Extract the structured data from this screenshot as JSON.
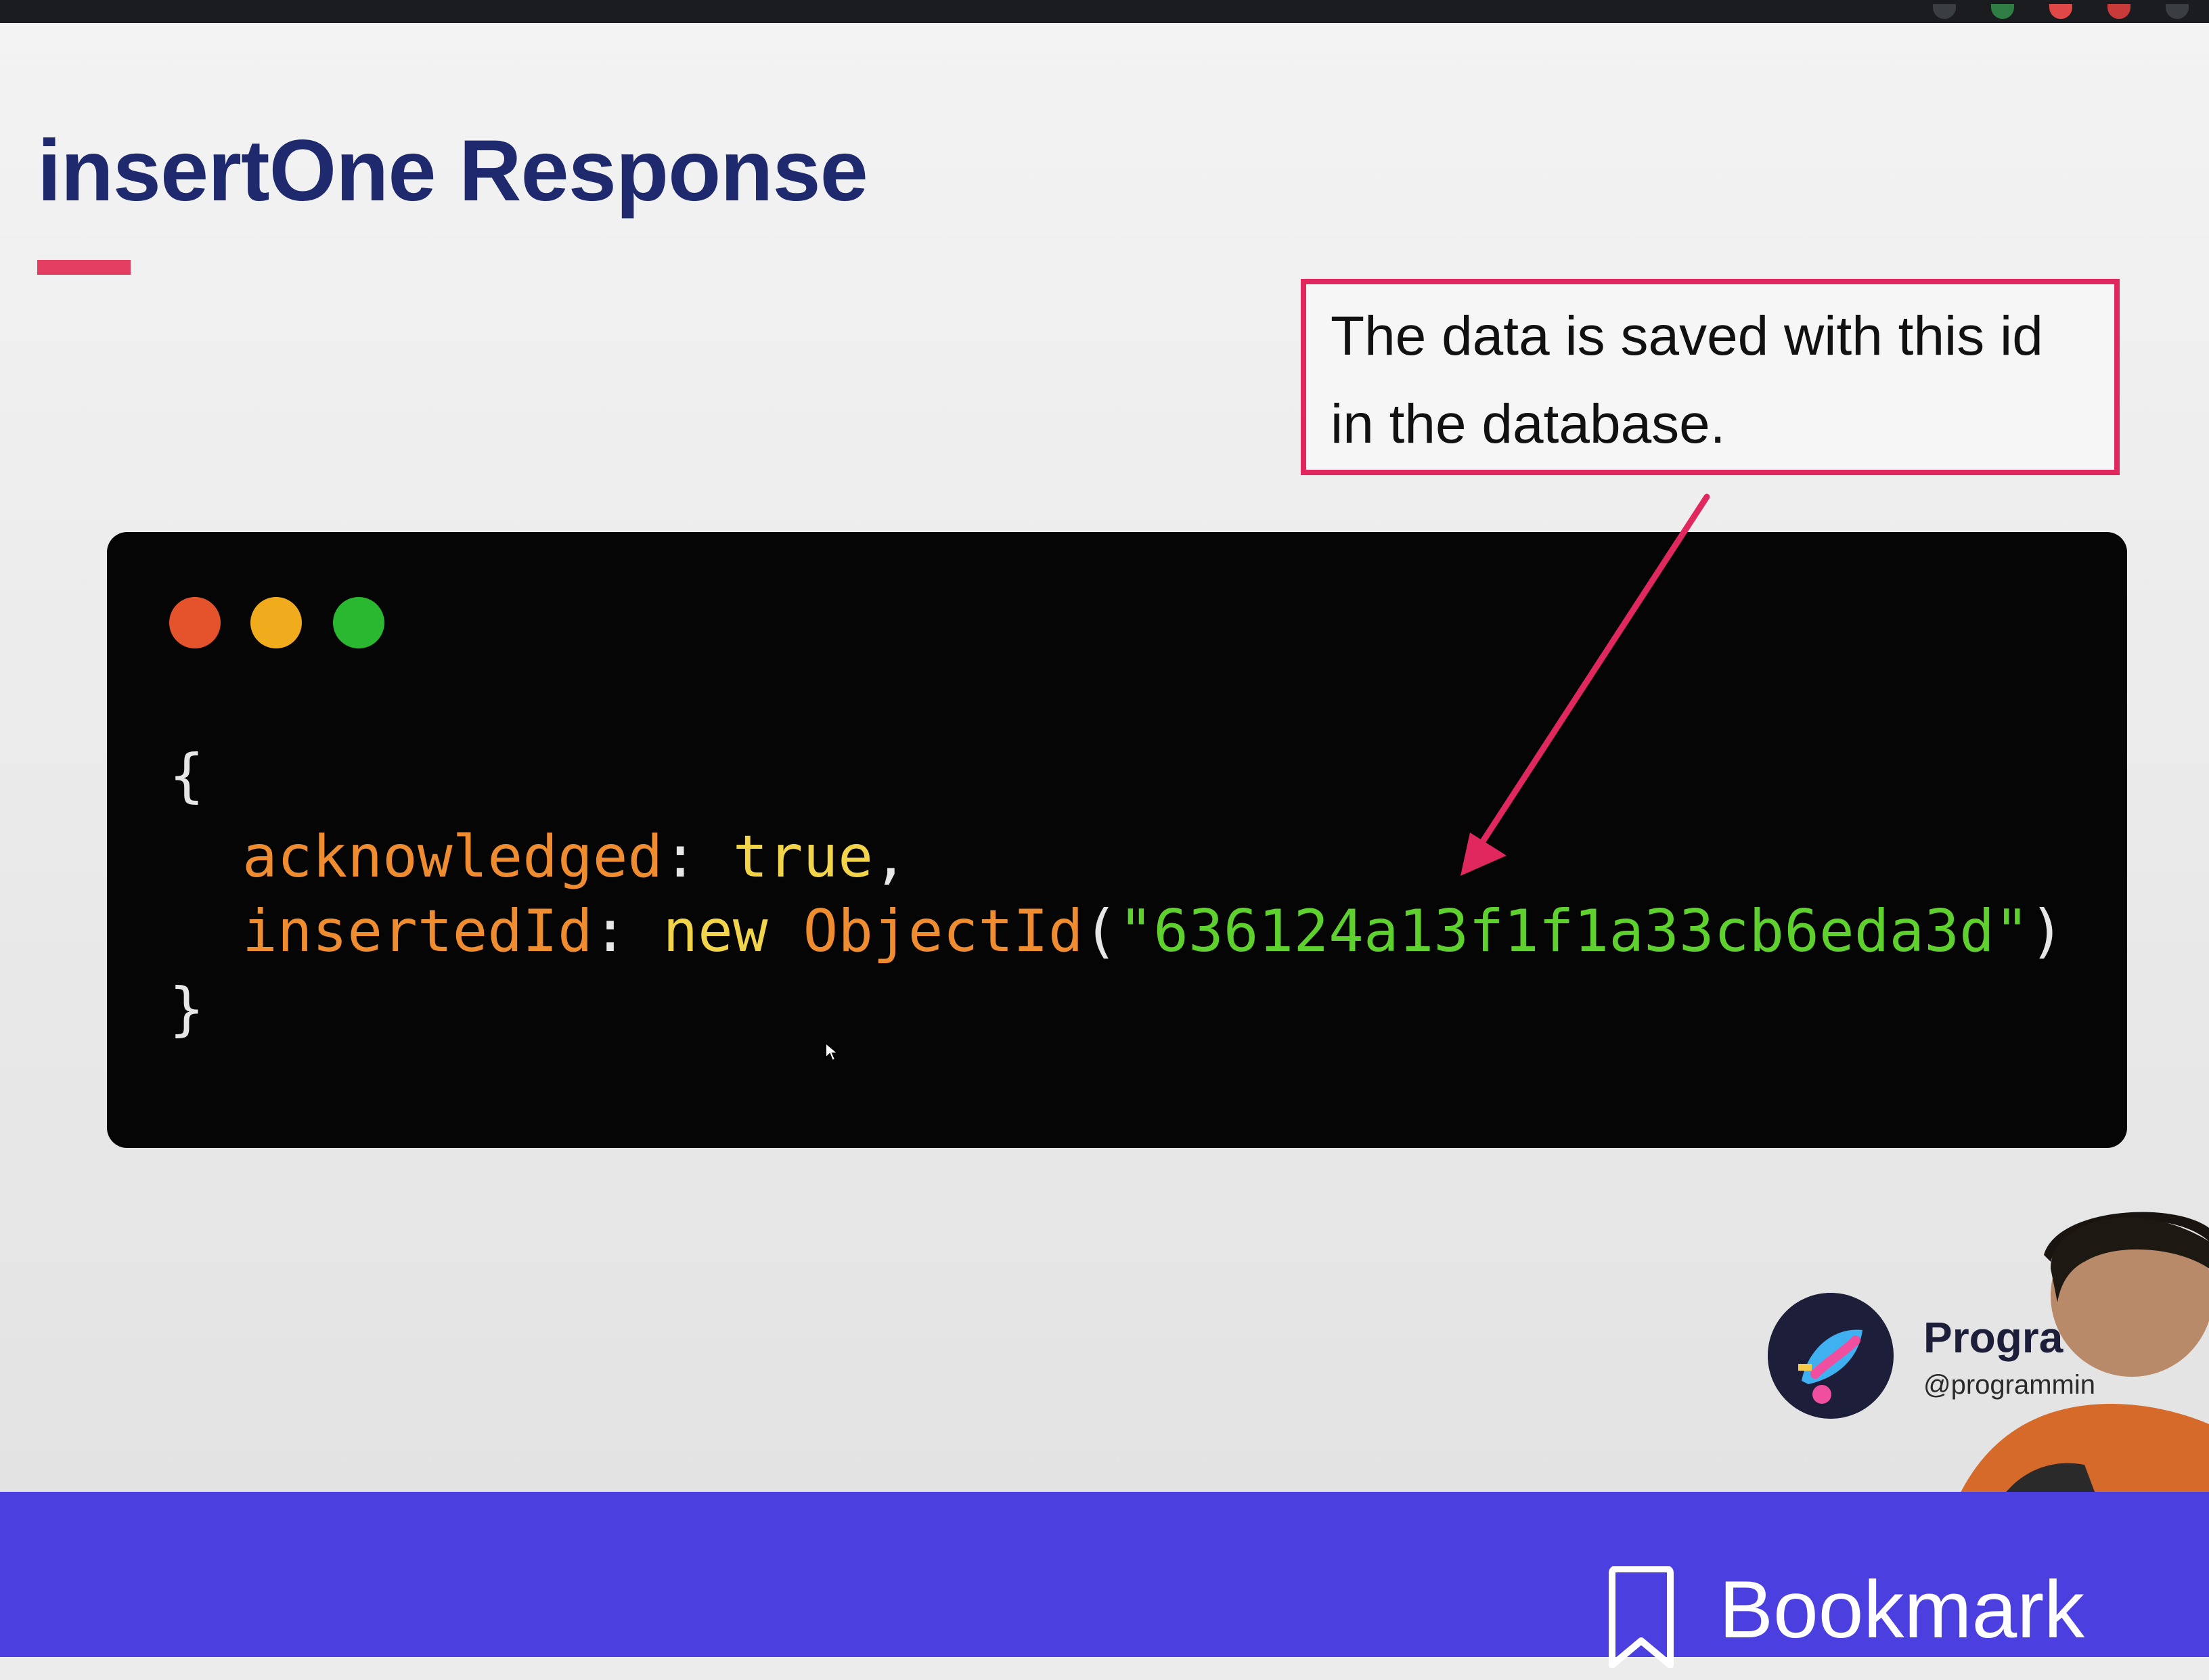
{
  "slide": {
    "title": "insertOne Response",
    "callout": {
      "line1": "The data is saved with this id",
      "line2": "in the database."
    }
  },
  "code": {
    "open_brace": "{",
    "close_brace": "}",
    "line1": {
      "key": "acknowledged",
      "colon": ": ",
      "value": "true",
      "comma": ","
    },
    "line2": {
      "key": "insertedId",
      "colon": ": ",
      "keyword": "new ",
      "class_name": "ObjectId",
      "open_paren": "(",
      "id_string": "\"636124a13f1f1a33cb6eda3d\"",
      "close_paren": ")"
    }
  },
  "channel": {
    "name": "Progra",
    "handle": "@programmin"
  },
  "bottom_bar": {
    "bookmark_label": "Bookmark"
  },
  "colors": {
    "title": "#1f2a6e",
    "accent_pink": "#e0285f",
    "code_bg": "#050505",
    "key_orange": "#ef8c30",
    "keyword_yellow": "#f2d44a",
    "string_green": "#5fd12f",
    "bottom_bar": "#4b3fe0"
  },
  "icons": [
    "window-close-dot-icon",
    "window-minimize-dot-icon",
    "window-maximize-dot-icon",
    "arrow-icon",
    "mouse-cursor-icon",
    "bookmark-icon",
    "channel-logo-icon"
  ]
}
